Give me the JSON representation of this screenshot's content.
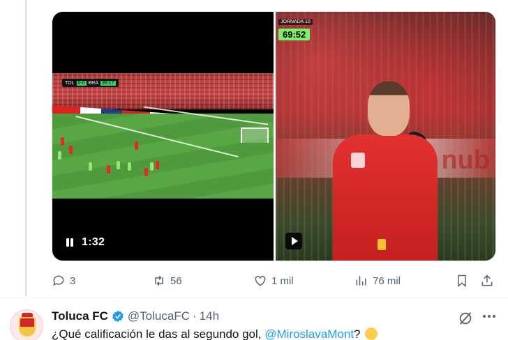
{
  "media": {
    "left_video": {
      "time_label": "1:32",
      "scoreboard": {
        "home": "TOL",
        "score": "0-0",
        "away": "BRA",
        "clock": "39:17"
      }
    },
    "right_video": {
      "jornada": "JORNADA 10",
      "clock": "69:52",
      "banner_text": "nub"
    }
  },
  "actions": {
    "replies": "3",
    "retweets": "56",
    "likes": "1 mil",
    "views": "76 mil"
  },
  "next_tweet": {
    "name": "Toluca FC",
    "handle": "@TolucaFC",
    "dot": "·",
    "time": "14h",
    "text_before": "¿Qué calificación le das al segundo gol, ",
    "mention": "@MiroslavaMont",
    "text_after": "?"
  },
  "colors": {
    "accent": "#1d9bf0",
    "muted": "#536471",
    "score_green": "#3ad36b"
  }
}
